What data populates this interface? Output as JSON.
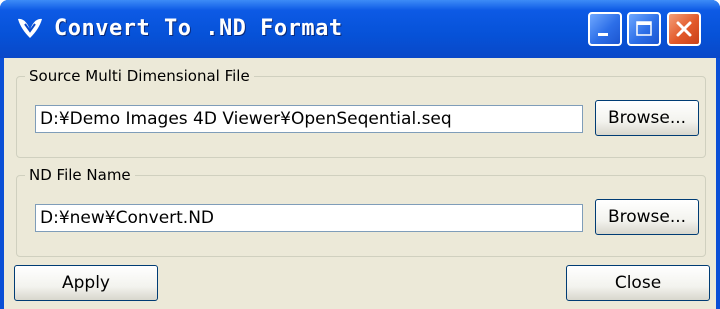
{
  "window": {
    "title": "Convert To .ND Format"
  },
  "titlebar_buttons": {
    "minimize_icon": "minimize-icon",
    "maximize_icon": "maximize-icon",
    "close_icon": "close-icon"
  },
  "source_group": {
    "label": "Source Multi Dimensional File",
    "path_value": "D:¥Demo Images 4D Viewer¥OpenSeqential.seq",
    "browse_label": "Browse..."
  },
  "nd_group": {
    "label": "ND File Name",
    "path_value": "D:¥new¥Convert.ND",
    "browse_label": "Browse..."
  },
  "actions": {
    "apply_label": "Apply",
    "close_label": "Close"
  },
  "colors": {
    "titlebar": "#0652d8",
    "client_bg": "#ece9d8",
    "close_button": "#e2592a"
  }
}
